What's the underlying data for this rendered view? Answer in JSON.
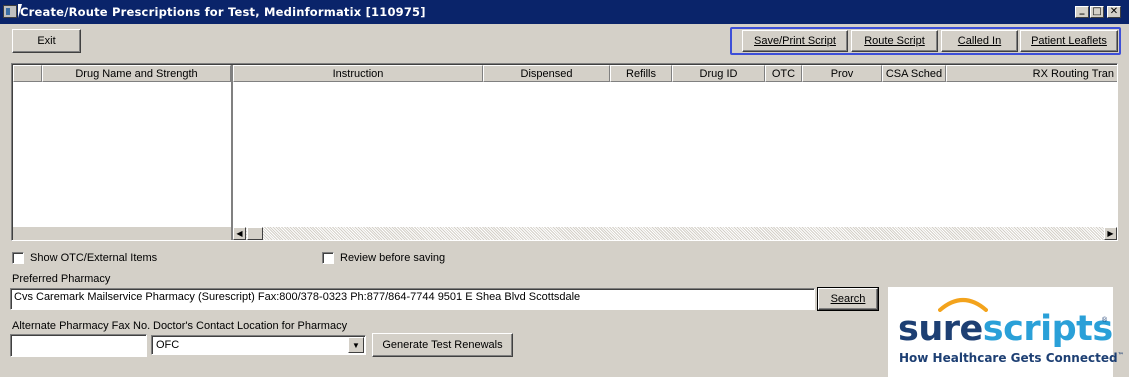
{
  "window": {
    "title": "Create/Route Prescriptions for Test, Medinformatix [110975]",
    "controls": {
      "minimize": "_",
      "maximize": "□",
      "close": "✕"
    }
  },
  "toolbar": {
    "exit_label": "Exit",
    "save_print_label": "Save/Print Script",
    "route_label": "Route Script",
    "called_in_label": "Called In",
    "patient_leaflets_label": "Patient Leaflets"
  },
  "grid": {
    "frozen_columns": [
      "",
      "Drug Name and Strength"
    ],
    "columns": [
      "Instruction",
      "Dispensed",
      "Refills",
      "Drug ID",
      "OTC",
      "Prov",
      "CSA Sched",
      "RX Routing Tran"
    ],
    "rows": []
  },
  "options": {
    "show_otc_label": "Show OTC/External Items",
    "show_otc_checked": false,
    "review_label": "Review before saving",
    "review_checked": false
  },
  "pharmacy": {
    "preferred_label": "Preferred Pharmacy",
    "preferred_value": "Cvs Caremark Mailservice Pharmacy (Surescript) Fax:800/378-0323 Ph:877/864-7744 9501 E Shea Blvd Scottsdale",
    "search_label": "Search",
    "alt_fax_label": "Alternate Pharmacy Fax No.",
    "alt_fax_value": "",
    "contact_location_label": "Doctor's Contact Location for Pharmacy",
    "contact_location_value": "OFC",
    "generate_label": "Generate Test Renewals"
  },
  "logo": {
    "word_part1": "sure",
    "word_part2": "scripts",
    "registered": "®",
    "tagline": "How Healthcare Gets Connected",
    "tm": "™",
    "colors": {
      "dark": "#1d3f73",
      "light": "#2aa0d8",
      "arc": "#f3a31c"
    }
  },
  "highlight_color": "#3d4fd8"
}
